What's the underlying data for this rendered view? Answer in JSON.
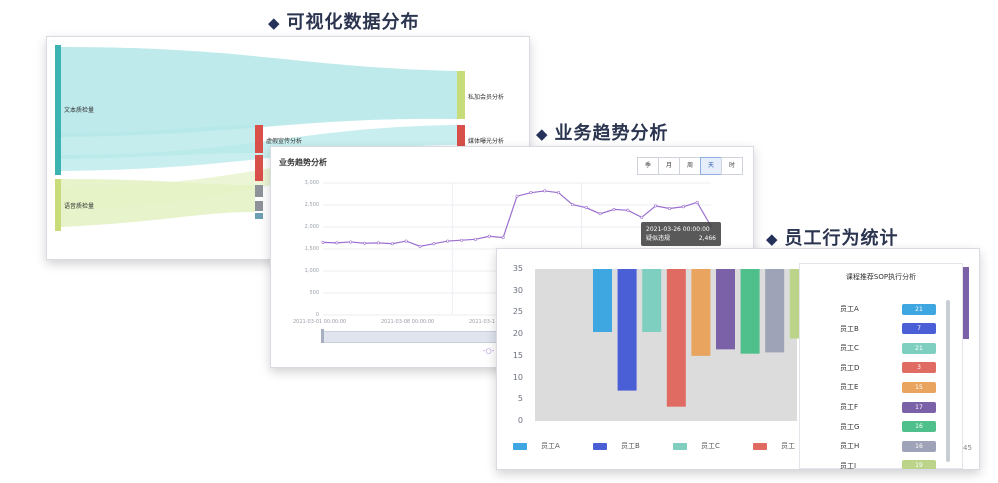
{
  "headings": {
    "viz": "可视化数据分布",
    "trend": "业务趋势分析",
    "staff": "员工行为统计"
  },
  "sankey": {
    "sources": [
      "文本质检量",
      "语音质检量"
    ],
    "targets": [
      "私加会员分析",
      "媒体曝光分析"
    ],
    "middle": [
      "虚假宣传分析"
    ],
    "colors": {
      "source1": "#3bb3b3",
      "source2": "#c8dd7a",
      "flow1": "#b7e8ea",
      "flow2": "#e4f2c5",
      "red": "#d9504a",
      "gray": "#8e939a"
    }
  },
  "trend": {
    "title": "业务趋势分析",
    "periods": [
      {
        "label": "季",
        "active": false
      },
      {
        "label": "月",
        "active": false
      },
      {
        "label": "周",
        "active": false
      },
      {
        "label": "天",
        "active": true
      },
      {
        "label": "时",
        "active": false
      }
    ],
    "yticks": [
      "3,000",
      "2,500",
      "2,000",
      "1,500",
      "1,000",
      "500",
      "0"
    ],
    "xticks": [
      "2021-03-01 00:00:00",
      "2021-03-08 00:00:00",
      "2021-03-1"
    ],
    "tooltip": {
      "time": "2021-03-26 00:00:00",
      "name": "疑似违规",
      "value": "2,466"
    },
    "chart_data": {
      "type": "line",
      "ylim": [
        0,
        3000
      ],
      "y": [
        1650,
        1640,
        1660,
        1630,
        1640,
        1620,
        1680,
        1560,
        1620,
        1680,
        1700,
        1720,
        1790,
        1760,
        2700,
        2780,
        2820,
        2780,
        2510,
        2440,
        2300,
        2400,
        2380,
        2220,
        2480,
        2420,
        2460,
        2560,
        2020
      ]
    },
    "line_color": "#9b6fd0"
  },
  "staff": {
    "yticks": [
      "35",
      "30",
      "25",
      "20",
      "15",
      "10",
      "5",
      "0"
    ],
    "chart_data": {
      "type": "bar",
      "ylim": [
        0,
        35
      ],
      "bars": [
        {
          "name": "员工A",
          "bottom": 20.5,
          "top": 35,
          "color": "#3ea6e0"
        },
        {
          "name": "员工B",
          "bottom": 7,
          "top": 35,
          "color": "#4a5fd6"
        },
        {
          "name": "员工C",
          "bottom": 20.5,
          "top": 35,
          "color": "#7fcfc0"
        },
        {
          "name": "员工D",
          "bottom": 3.3,
          "top": 35,
          "color": "#e06b62"
        },
        {
          "name": "员工E",
          "bottom": 15,
          "top": 35,
          "color": "#e9a45f"
        },
        {
          "name": "员工F",
          "bottom": 16.5,
          "top": 35,
          "color": "#7b62a8"
        },
        {
          "name": "员工G",
          "bottom": 15.5,
          "top": 35,
          "color": "#4fbf8c"
        },
        {
          "name": "员工H",
          "bottom": 15.8,
          "top": 35,
          "color": "#9ea3b8"
        },
        {
          "name": "员工I",
          "bottom": 19,
          "top": 35,
          "color": "#bcd48a"
        }
      ]
    },
    "legend": [
      {
        "label": "员工A",
        "color": "#3ea6e0"
      },
      {
        "label": "员工B",
        "color": "#4a5fd6"
      },
      {
        "label": "员工C",
        "color": "#7fcfc0"
      },
      {
        "label": "员工",
        "color": "#e06b62"
      }
    ],
    "panel": {
      "title": "课程推荐SOP执行分析",
      "rows": [
        {
          "name": "员工A",
          "value": "21",
          "color": "#3ea6e0"
        },
        {
          "name": "员工B",
          "value": "7",
          "color": "#4a5fd6"
        },
        {
          "name": "员工C",
          "value": "21",
          "color": "#7fcfc0"
        },
        {
          "name": "员工D",
          "value": "3",
          "color": "#e06b62"
        },
        {
          "name": "员工E",
          "value": "15",
          "color": "#e9a45f"
        },
        {
          "name": "员工F",
          "value": "17",
          "color": "#7b62a8"
        },
        {
          "name": "员工G",
          "value": "16",
          "color": "#4fbf8c"
        },
        {
          "name": "员工H",
          "value": "16",
          "color": "#9ea3b8"
        },
        {
          "name": "员工I",
          "value": "19",
          "color": "#bcd48a"
        }
      ]
    },
    "edge_label": "45"
  }
}
